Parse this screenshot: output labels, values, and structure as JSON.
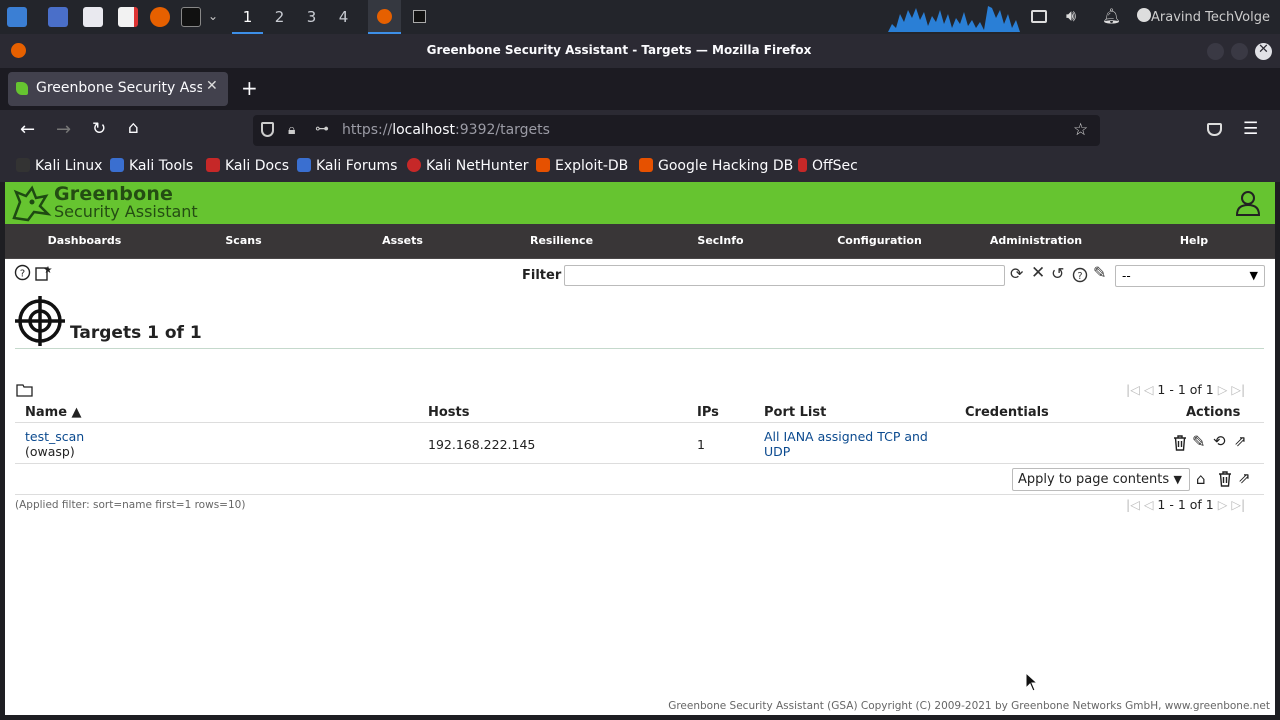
{
  "taskbar": {
    "workspaces": [
      "1",
      "2",
      "3",
      "4"
    ],
    "tray_text": "Aravind TechVolge"
  },
  "window": {
    "title": "Greenbone Security Assistant - Targets — Mozilla Firefox"
  },
  "browser": {
    "tab_title": "Greenbone Security Assis",
    "new_tab": "+",
    "url_prefix": "https://",
    "url_host": "localhost",
    "url_rest": ":9392/targets",
    "bookmarks": [
      "Kali Linux",
      "Kali Tools",
      "Kali Docs",
      "Kali Forums",
      "Kali NetHunter",
      "Exploit-DB",
      "Google Hacking DB",
      "OffSec"
    ]
  },
  "gsa": {
    "logo_line1": "Greenbone",
    "logo_line2": "Security Assistant",
    "nav": [
      "Dashboards",
      "Scans",
      "Assets",
      "Resilience",
      "SecInfo",
      "Configuration",
      "Administration",
      "Help"
    ],
    "filter_label": "Filter",
    "filter_value": "",
    "filter_select": "--",
    "page_title": "Targets 1 of 1",
    "pager_text": "1 - 1 of 1",
    "columns": [
      "Name ▲",
      "Hosts",
      "IPs",
      "Port List",
      "Credentials",
      "Actions"
    ],
    "rows": [
      {
        "name": "test_scan",
        "comment": "(owasp)",
        "hosts": "192.168.222.145",
        "ips": "1",
        "port_list_line1": "All IANA assigned TCP and",
        "port_list_line2": "UDP",
        "credentials": ""
      }
    ],
    "bulk_select": "Apply to page contents",
    "applied_filter": "(Applied filter: sort=name first=1 rows=10)",
    "footer": "Greenbone Security Assistant (GSA) Copyright (C) 2009-2021 by Greenbone Networks GmbH, www.greenbone.net"
  },
  "colors": {
    "gsa_green": "#66c430",
    "gsa_nav": "#393637",
    "link": "#0b4a8f"
  }
}
